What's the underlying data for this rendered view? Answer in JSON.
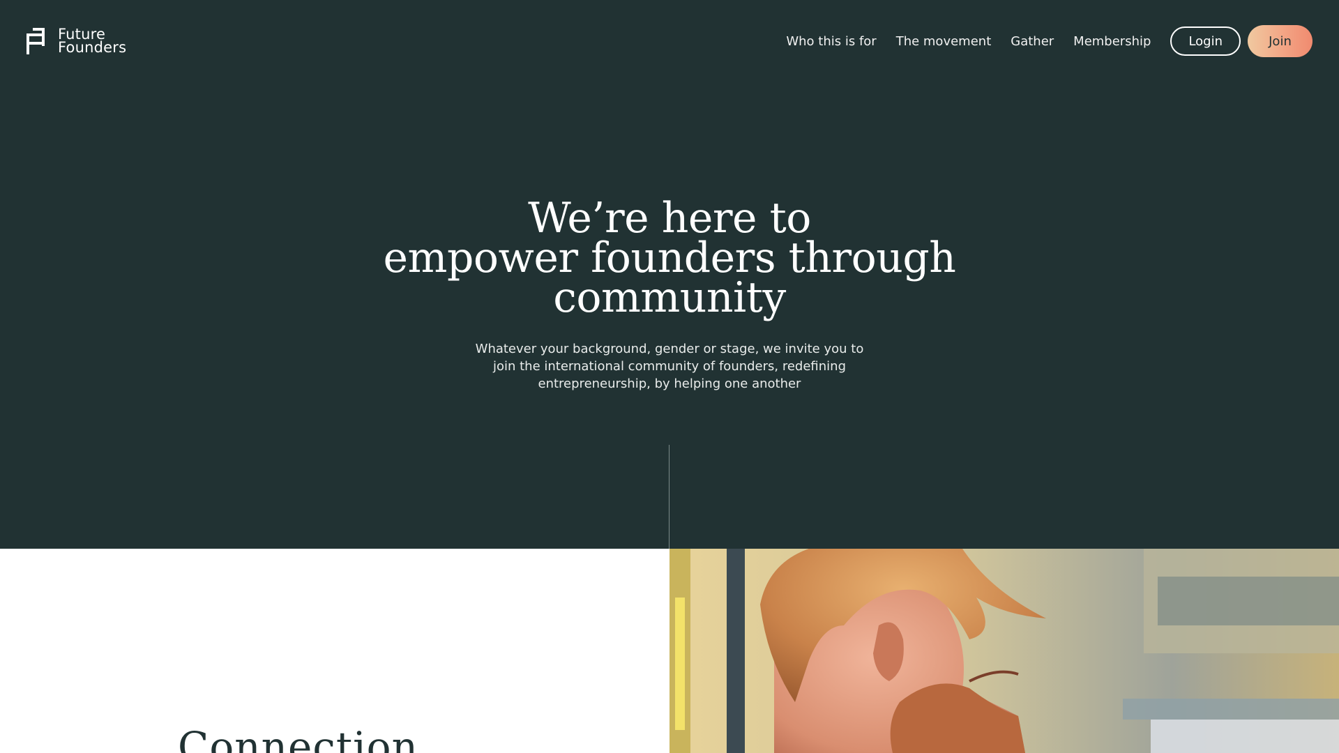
{
  "brand": {
    "line1": "Future",
    "line2": "Founders"
  },
  "nav": {
    "links": [
      "Who this is for",
      "The movement",
      "Gather",
      "Membership"
    ],
    "login_label": "Login",
    "join_label": "Join"
  },
  "hero": {
    "title_lines": [
      "We’re here to",
      "empower founders through",
      "community"
    ],
    "subtitle": "Whatever your background, gender or stage, we invite you to join the international community of founders, redefining entrepreneurship, by helping one another"
  },
  "section": {
    "heading": "Connection"
  },
  "colors": {
    "background": "#213233",
    "join_gradient_start": "#f0c9a0",
    "join_gradient_end": "#f08a6f",
    "panel": "#ffffff"
  },
  "icons": {
    "logo": "future-founders-logo-icon"
  }
}
